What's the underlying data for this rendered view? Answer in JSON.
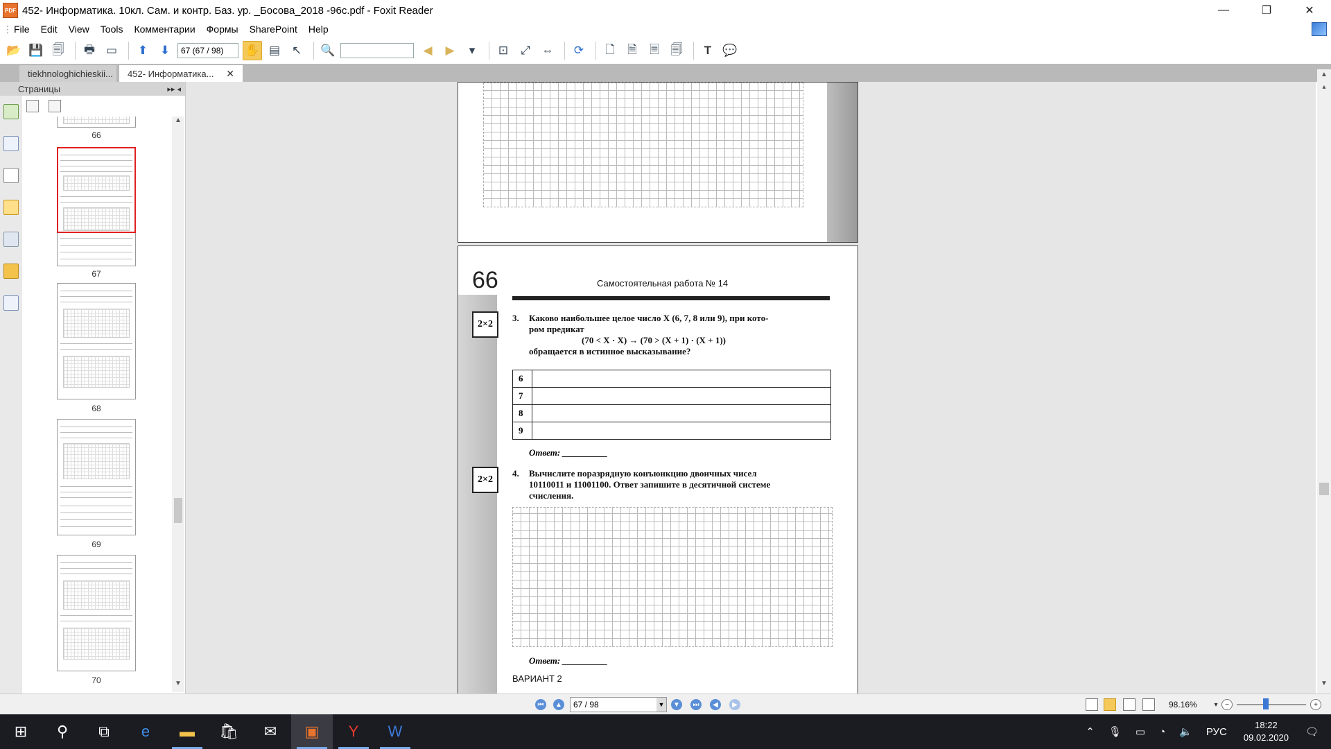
{
  "window": {
    "title": "452- Информатика. 10кл. Сам. и контр. Баз. ур. _Босова_2018 -96с.pdf - Foxit Reader",
    "app_icon_label": "PDF",
    "controls": {
      "minimize": "—",
      "restore": "❐",
      "close": "✕"
    }
  },
  "menu": [
    "File",
    "Edit",
    "View",
    "Tools",
    "Комментарии",
    "Формы",
    "SharePoint",
    "Help"
  ],
  "toolbar": {
    "page_field": "67 (67 / 98)",
    "find_placeholder": ""
  },
  "tabs": [
    {
      "label": "tiekhnologhichieskii...",
      "active": false
    },
    {
      "label": "452- Информатика...",
      "active": true,
      "close": "✕"
    }
  ],
  "left_panel": {
    "header": "Страницы",
    "header_controls": "▸▸ ◂",
    "thumbnails": [
      {
        "label": "66"
      },
      {
        "label": "67",
        "selected": true
      },
      {
        "label": "68"
      },
      {
        "label": "69"
      },
      {
        "label": "70"
      }
    ]
  },
  "document": {
    "page_number": "66",
    "page_heading": "Самостоятельная работа № 14",
    "task3": {
      "badge": "2×2",
      "number": "3.",
      "line1": "Каково наибольшее целое число X (6, 7, 8 или 9), при кото-",
      "line2": "ром предикат",
      "formula": "(70 < X · X) → (70 > (X + 1) · (X + 1))",
      "line3": "обращается в истинное высказывание?",
      "table_rows": [
        "6",
        "7",
        "8",
        "9"
      ],
      "answer": "Ответ: __________"
    },
    "task4": {
      "badge": "2×2",
      "number": "4.",
      "line1": "Вычислите поразрядную конъюнкцию двоичных чисел",
      "line2": "10110011 и 11001100. Ответ запишите в десятичной системе",
      "line3": "счисления.",
      "answer": "Ответ: __________"
    },
    "variant": "ВАРИАНТ 2"
  },
  "statusbar": {
    "page_field": "67 / 98",
    "zoom": "98.16%"
  },
  "taskbar": {
    "tray_lang": "РУС",
    "time": "18:22",
    "date": "09.02.2020"
  }
}
